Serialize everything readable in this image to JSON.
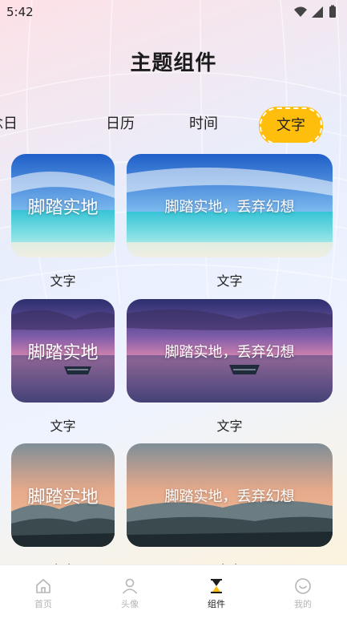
{
  "status_bar": {
    "time": "5:42"
  },
  "header": {
    "title": "主题组件"
  },
  "tabs": [
    {
      "label": "纪念日"
    },
    {
      "label": "日历"
    },
    {
      "label": "时间"
    },
    {
      "label": "文字",
      "selected": true
    }
  ],
  "widgets": {
    "row1": {
      "scene": "beach",
      "small_text": "脚踏实地",
      "wide_text": "脚踏实地，丢弃幻想",
      "small_caption": "文字",
      "wide_caption": "文字"
    },
    "row2": {
      "scene": "sunset-boat",
      "small_text": "脚踏实地",
      "wide_text": "脚踏实地，丢弃幻想",
      "small_caption": "文字",
      "wide_caption": "文字"
    },
    "row3": {
      "scene": "mountains",
      "small_text": "脚踏实地",
      "wide_text": "脚踏实地，丢弃幻想",
      "small_caption": "文字",
      "wide_caption": "文字"
    }
  },
  "bottom_nav": [
    {
      "label": "首页",
      "icon": "home-icon"
    },
    {
      "label": "头像",
      "icon": "avatar-icon"
    },
    {
      "label": "组件",
      "icon": "hourglass-icon",
      "active": true
    },
    {
      "label": "我的",
      "icon": "smile-icon"
    }
  ],
  "colors": {
    "accent": "#ffbe0b",
    "nav_inactive": "#b5b5b5"
  }
}
